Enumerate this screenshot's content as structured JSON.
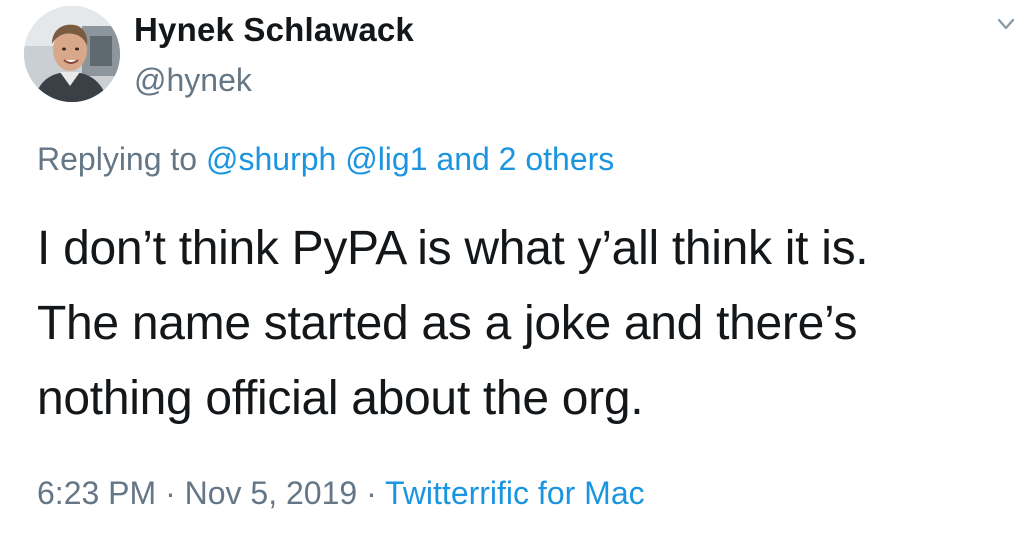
{
  "author": {
    "display_name": "Hynek Schlawack",
    "handle": "@hynek",
    "avatar_icon": "profile-photo"
  },
  "reply": {
    "prefix": "Replying to",
    "mentions": [
      "@shurph",
      "@lig1"
    ],
    "and_others": "and 2 others"
  },
  "tweet": {
    "lines": [
      "I don’t think PyPA is what y’all think it is.",
      "The name started as a joke and there’s",
      "nothing official about the org."
    ]
  },
  "meta": {
    "time": "6:23 PM",
    "separator": "·",
    "date": "Nov 5, 2019",
    "source": "Twitterrific for Mac"
  },
  "menu_icon": "chevron-down-icon",
  "colors": {
    "text": "#14171a",
    "muted": "#657786",
    "link": "#1b95e0"
  }
}
